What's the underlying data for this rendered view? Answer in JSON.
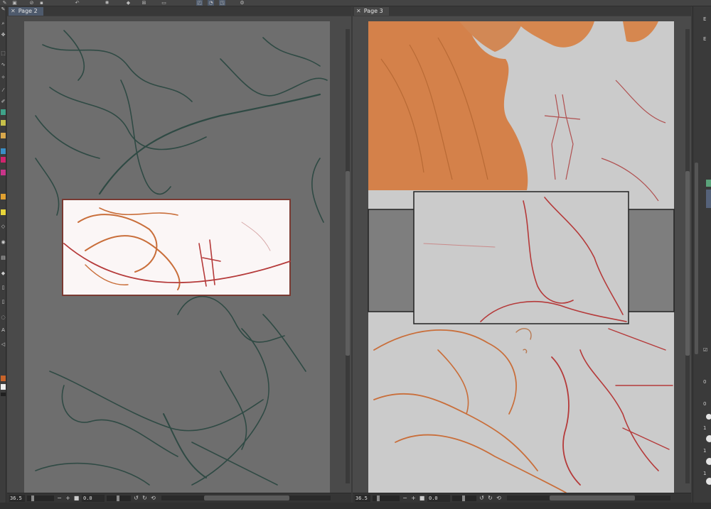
{
  "tabs": {
    "left": {
      "label": "Page 2",
      "close": "✕"
    },
    "right": {
      "label": "Page 3",
      "close": "✕"
    }
  },
  "status": {
    "left": {
      "zoom": "36.5",
      "minus": "−",
      "plus": "+",
      "fit": "■",
      "angle": "0.0"
    },
    "right": {
      "zoom": "36.5",
      "minus": "−",
      "plus": "+",
      "fit": "■",
      "angle": "0.0"
    }
  },
  "right_dock": {
    "labels": [
      "E",
      "E",
      "0",
      "0",
      "1",
      "1",
      "1"
    ]
  },
  "colors": {
    "canvas_left": "#6e6e6e",
    "canvas_right": "#cbcbcb",
    "sketch_green": "#2f4a44",
    "sketch_red": "#b53a3a",
    "sketch_orange": "#c96e3a",
    "tab_active": "#4e5a6c"
  },
  "icons": [
    "brush-icon",
    "lasso-icon",
    "move-icon",
    "eyedropper-icon",
    "pen-icon",
    "eraser-icon",
    "fill-icon",
    "text-icon",
    "rotate-left-icon",
    "rotate-right-icon",
    "reset-icon",
    "undo-icon",
    "redo-icon"
  ]
}
